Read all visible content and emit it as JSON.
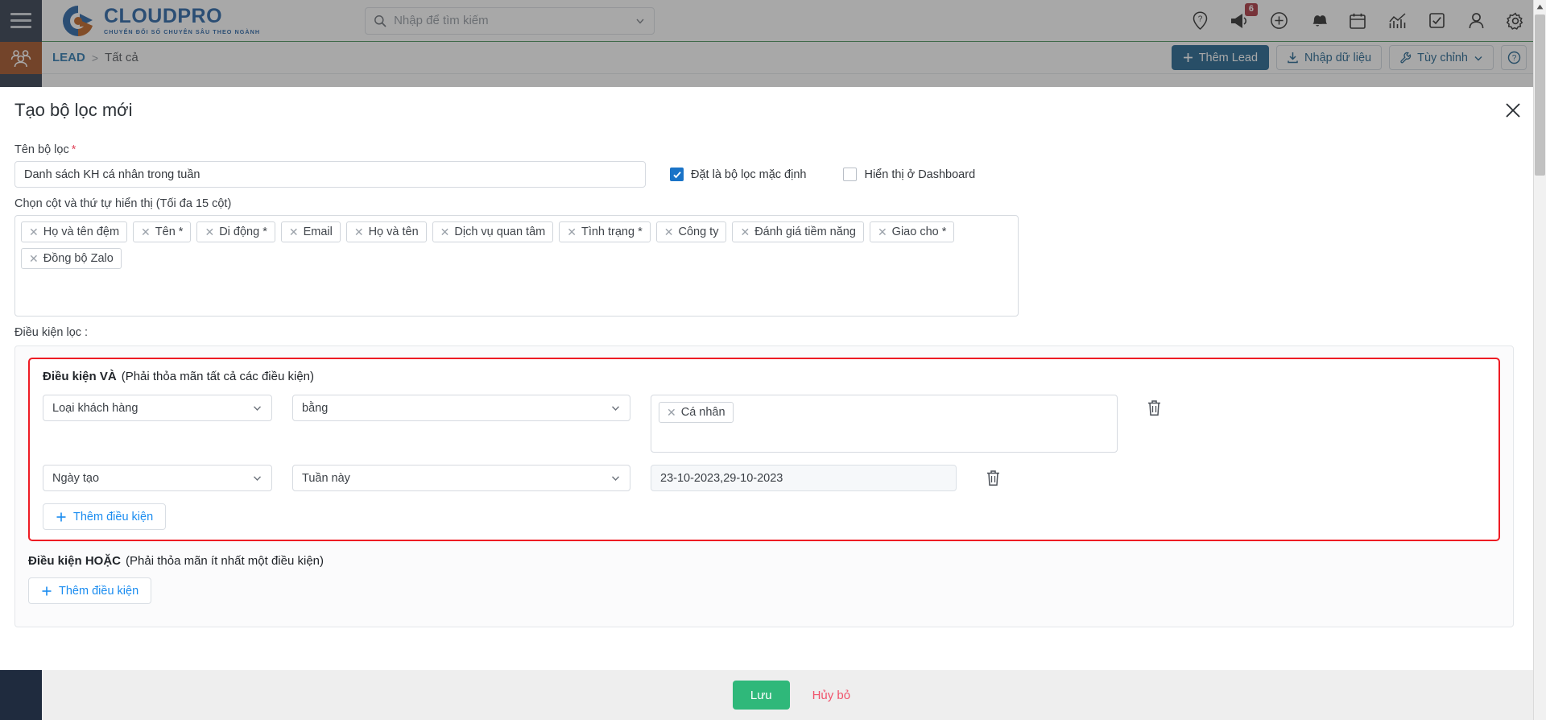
{
  "brand": {
    "name": "CLOUDPRO",
    "tagline": "CHUYỂN ĐỔI SỐ CHUYÊN SÂU THEO NGÀNH",
    "colors": {
      "logo_blue": "#14559e",
      "logo_orange": "#b8530f",
      "accent_green": "#2fb87a",
      "danger": "#ee1c24",
      "primary_blue": "#0e5584"
    }
  },
  "topbar": {
    "search": {
      "placeholder": "Nhập để tìm kiếm"
    },
    "icons": [
      {
        "name": "help-pin-icon"
      },
      {
        "name": "megaphone-icon",
        "badge": "6"
      },
      {
        "name": "plus-circle-icon"
      },
      {
        "name": "bells-icon"
      },
      {
        "name": "calendar-icon"
      },
      {
        "name": "chart-icon"
      },
      {
        "name": "checkbox-task-icon"
      },
      {
        "name": "user-icon"
      },
      {
        "name": "gear-icon"
      }
    ]
  },
  "breadcrumb": {
    "module": "LEAD",
    "separator": ">",
    "current": "Tất cả",
    "actions": {
      "add_lead": "Thêm Lead",
      "import": "Nhập dữ liệu",
      "customize": "Tùy chỉnh",
      "help": "?"
    }
  },
  "modal": {
    "title": "Tạo bộ lọc mới",
    "close": "✕",
    "filter_name": {
      "label": "Tên bộ lọc",
      "required_mark": "*",
      "value": "Danh sách KH cá nhân trong tuần",
      "placeholder": ""
    },
    "checkboxes": [
      {
        "label": "Đặt là bộ lọc mặc định",
        "checked": true
      },
      {
        "label": "Hiển thị ở Dashboard",
        "checked": false
      }
    ],
    "columns": {
      "label": "Chọn cột và thứ tự hiển thị (Tối đa 15 cột)",
      "tags": [
        "Họ và tên đệm",
        "Tên *",
        "Di động *",
        "Email",
        "Họ và tên",
        "Dịch vụ quan tâm",
        "Tình trạng *",
        "Công ty",
        "Đánh giá tiềm năng",
        "Giao cho *",
        "Đồng bộ Zalo"
      ]
    },
    "conditions": {
      "label": "Điều kiện lọc :",
      "and_group": {
        "title": "Điều kiện VÀ",
        "hint": "(Phải thỏa mãn tất cả các điều kiện)",
        "rows": [
          {
            "field": "Loại khách hàng",
            "operator": "bằng",
            "value_type": "tags",
            "value_tags": [
              "Cá nhân"
            ],
            "delete_icon": "trash-icon"
          },
          {
            "field": "Ngày tạo",
            "operator": "Tuần này",
            "value_type": "text",
            "value_text": "23-10-2023,29-10-2023",
            "delete_icon": "trash-icon"
          }
        ],
        "add_label": "Thêm điều kiện"
      },
      "or_group": {
        "title": "Điều kiện HOẶC",
        "hint": "(Phải thỏa mãn ít nhất một điều kiện)",
        "add_label": "Thêm điều kiện"
      }
    },
    "footer": {
      "save": "Lưu",
      "cancel": "Hủy bỏ"
    }
  }
}
